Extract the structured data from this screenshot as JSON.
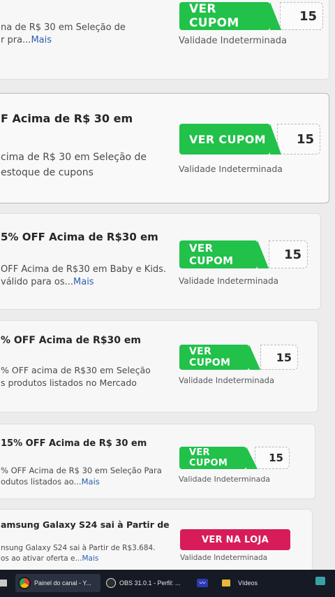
{
  "cards": [
    {
      "title": "",
      "desc": [
        "na de R$ 30 em Seleção de",
        "r pra..."
      ],
      "more": "Mais",
      "button": "VER CUPOM",
      "code": "15",
      "validity": "Validade Indeterminada"
    },
    {
      "title": "F Acima de R$ 30 em",
      "desc": [
        "cima de R$ 30 em Seleção de",
        "estoque de cupons"
      ],
      "more": "",
      "button": "VER CUPOM",
      "code": "15",
      "validity": "Validade Indeterminada"
    },
    {
      "title": "5% OFF Acima de R$30 em",
      "desc": [
        "OFF Acima de R$30 em Baby e Kids.",
        "válido para os..."
      ],
      "more": "Mais",
      "button": "VER CUPOM",
      "code": "15",
      "validity": "Validade Indeterminada"
    },
    {
      "title": "% OFF Acima de R$30 em",
      "desc": [
        "% OFF acima de R$30 em Seleção",
        "s produtos listados no Mercado"
      ],
      "more": "",
      "button": "VER CUPOM",
      "code": "15",
      "validity": "Validade Indeterminada"
    },
    {
      "title": "15% OFF Acima de R$ 30 em",
      "desc": [
        "% OFF Acima de R$ 30 em Seleção Para",
        "odutos listados ao..."
      ],
      "more": "Mais",
      "button": "VER CUPOM",
      "code": "15",
      "validity": "Validade Indeterminada"
    },
    {
      "title": "amsung Galaxy S24 sai à Partir de",
      "desc": [
        "nsung Galaxy S24 sai à Partir de R$3.684.",
        "os ao ativar oferta e..."
      ],
      "more": "Mais",
      "button": "VER NA LOJA",
      "code": "",
      "validity": "Validade Indeterminada"
    }
  ],
  "colors": {
    "coupon_button": "#21c14a",
    "store_button": "#d81c5a",
    "link": "#2a5fb0"
  },
  "taskbar": {
    "items": [
      {
        "label": "Painel do canal - Y...",
        "icon": "chrome-icon"
      },
      {
        "label": "OBS 31.0.1 - Perfil: ...",
        "icon": "obs-icon"
      },
      {
        "label": "",
        "icon": "audio-wave-icon"
      },
      {
        "label": "Vídeos",
        "icon": "folder-icon"
      }
    ]
  }
}
